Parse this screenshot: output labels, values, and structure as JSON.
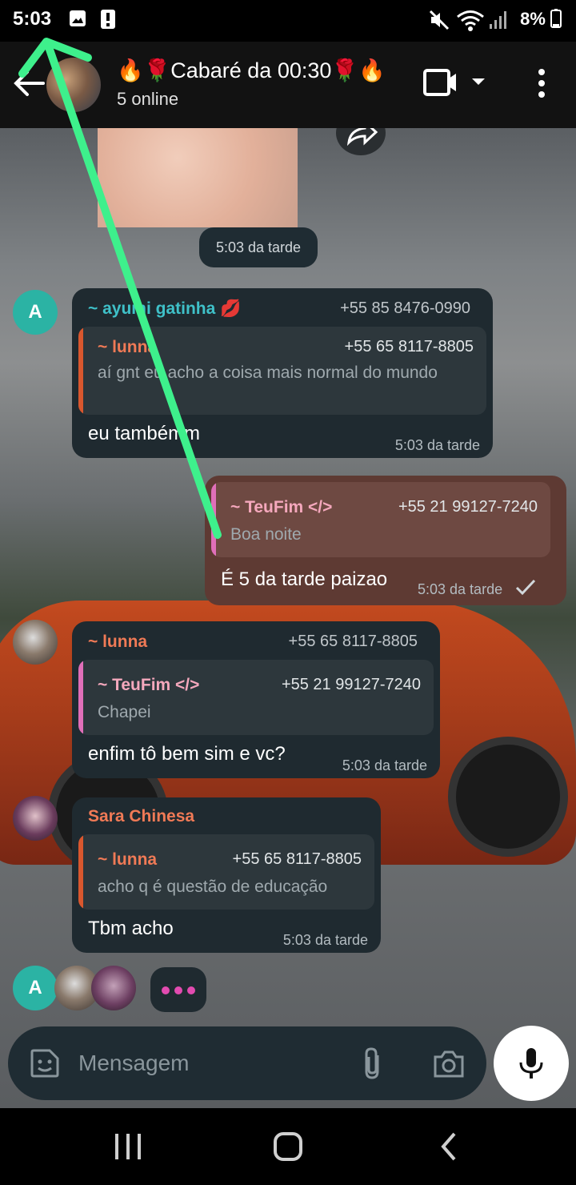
{
  "status_bar": {
    "time": "5:03",
    "battery": "8%"
  },
  "header": {
    "title": "🔥🌹Cabaré da 00:30🌹🔥",
    "subtitle": "5 online",
    "icons": [
      "back-arrow-icon",
      "video-call-icon",
      "chevron-down-icon",
      "more-vert-icon"
    ]
  },
  "chat": {
    "date_pill": "5:03 da tarde",
    "messages": [
      {
        "sender": "~ ayumi gatinha 💋",
        "sender_color": "#3fc1c9",
        "phone": "+55 85 8476-0990",
        "avatar_letter": "A",
        "quote": {
          "author": "~ lunna",
          "author_color": "#f07a56",
          "phone": "+55 65 8117-8805",
          "text": "aí gnt eu acho a coisa mais normal do mundo",
          "bar_color": "#d9572e"
        },
        "text": "eu tambémm",
        "time": "5:03 da tarde"
      },
      {
        "outgoing": true,
        "quote": {
          "author": "~ TeuFim </>",
          "author_color": "#f5a8bd",
          "phone": "+55 21 99127-7240",
          "text": "Boa noite",
          "bar_color": "#e06fb9"
        },
        "text": "É 5 da tarde paizao",
        "time": "5:03 da tarde",
        "status_icon": "check-icon"
      },
      {
        "sender": "~ lunna",
        "sender_color": "#f07a56",
        "phone": "+55 65 8117-8805",
        "quote": {
          "author": "~ TeuFim </>",
          "author_color": "#f5a8bd",
          "phone": "+55 21 99127-7240",
          "text": "Chapei",
          "bar_color": "#e06fb9"
        },
        "text": "enfim tô bem sim e vc?",
        "time": "5:03 da tarde"
      },
      {
        "sender": "Sara Chinesa",
        "sender_color": "#f07a56",
        "quote": {
          "author": "~ lunna",
          "author_color": "#f07a56",
          "phone": "+55 65 8117-8805",
          "text": "acho q é questão de educação",
          "bar_color": "#d9572e"
        },
        "text": "Tbm acho",
        "time": "5:03 da tarde"
      }
    ],
    "typing_avatars_letter": "A"
  },
  "composer": {
    "placeholder": "Mensagem",
    "icons": [
      "sticker-icon",
      "paperclip-icon",
      "camera-icon",
      "microphone-icon"
    ]
  },
  "nav": {
    "icons": [
      "recent-apps-icon",
      "home-icon",
      "back-icon"
    ]
  },
  "annotation_color": "#3ef08c"
}
